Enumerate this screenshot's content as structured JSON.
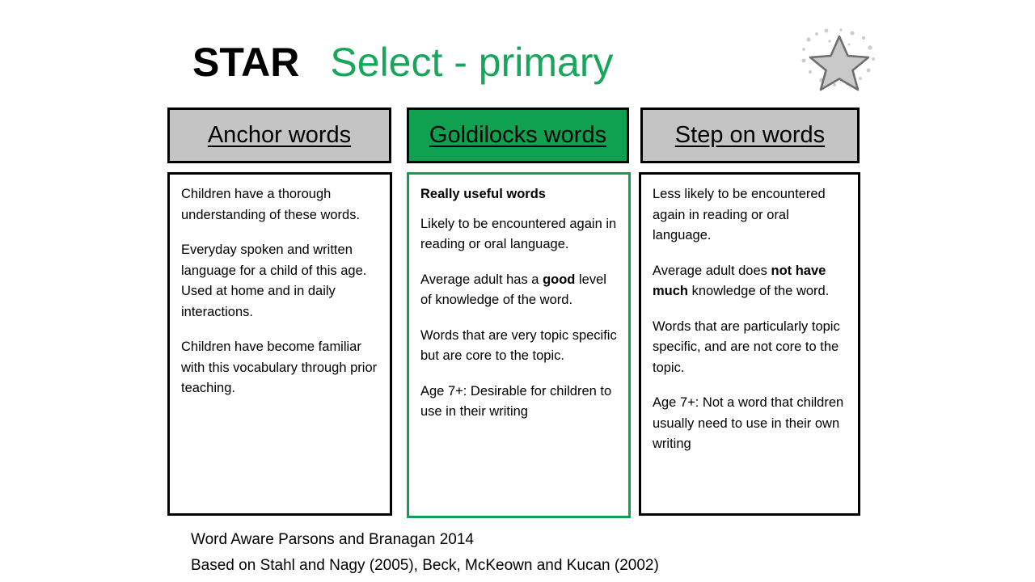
{
  "title": {
    "brand": "STAR",
    "subtitle": "Select - primary"
  },
  "decoration": {
    "star_icon": "star-icon",
    "star_fill": "#C9C9C9",
    "star_stroke": "#6E6E6E"
  },
  "colors": {
    "green": "#0FA14F",
    "green_text": "#18A65B",
    "grey_header": "#C4C4C4",
    "black": "#000000"
  },
  "columns": [
    {
      "id": "anchor",
      "header": "Anchor words",
      "header_bg": "#C4C4C4",
      "border": "#000000",
      "lead": null,
      "paragraphs": [
        {
          "html": "Children have a thorough understanding of these words."
        },
        {
          "html": "Everyday spoken and written language for a child of this age."
        },
        {
          "html": "Used at home and in daily interactions."
        },
        {
          "html": "Children have become familiar with this vocabulary through prior teaching."
        }
      ]
    },
    {
      "id": "goldilocks",
      "header": "Goldilocks words",
      "header_bg": "#0FA14F",
      "border": "#0FA14F",
      "lead": "Really useful words",
      "paragraphs": [
        {
          "html": "Likely to be encountered again in reading or oral language."
        },
        {
          "html": "Average adult has a <b>good</b> level of knowledge of the word."
        },
        {
          "html": "Words that are very topic specific but are core to the topic."
        },
        {
          "html": "Age 7+: Desirable for children to use in their writing"
        }
      ]
    },
    {
      "id": "step-on",
      "header": "Step on words",
      "header_bg": "#C4C4C4",
      "border": "#000000",
      "lead": null,
      "paragraphs": [
        {
          "html": "Less likely to be encountered again in reading or oral language."
        },
        {
          "html": "Average adult does <b>not have much</b> knowledge of the word."
        },
        {
          "html": "Words that are particularly topic specific, and are not core to the topic."
        },
        {
          "html": "Age 7+: Not a word that children usually need to use in their own writing"
        }
      ]
    }
  ],
  "footer": {
    "line1": "Word Aware Parsons and Branagan 2014",
    "line2": "Based on Stahl and Nagy (2005), Beck, McKeown and Kucan (2002)"
  }
}
